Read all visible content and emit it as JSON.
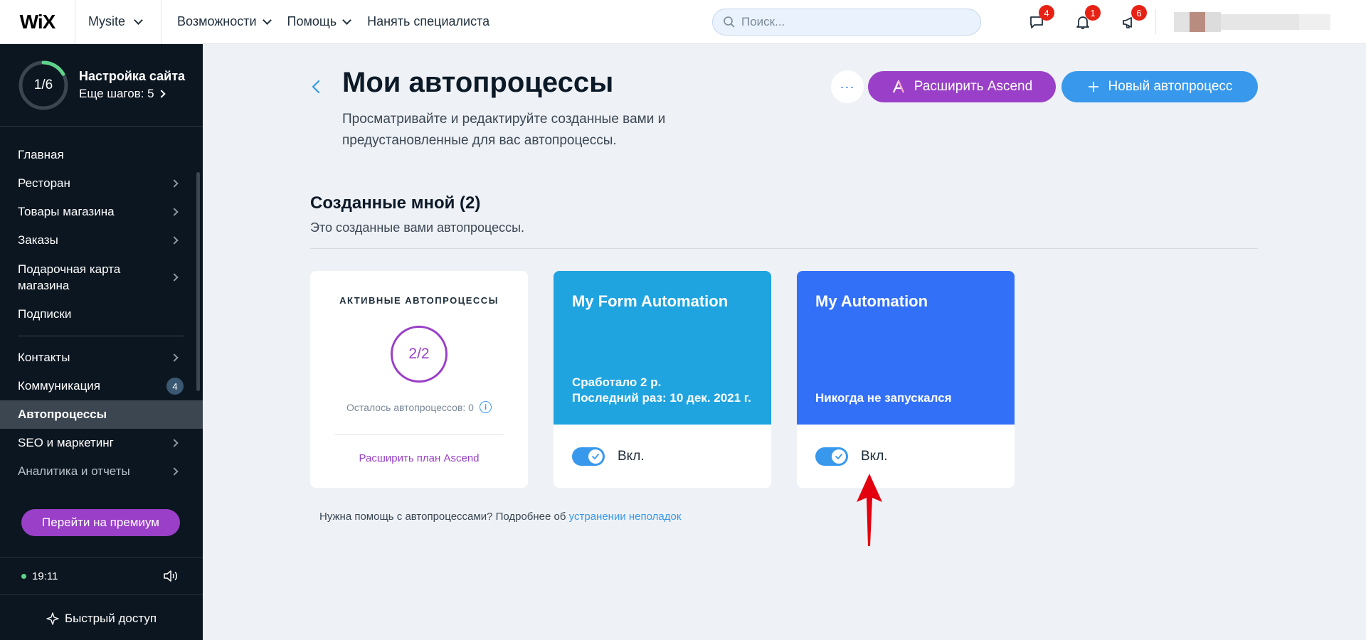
{
  "topbar": {
    "logo": "WiX",
    "site_name": "Mysite",
    "nav": [
      {
        "label": "Возможности",
        "has_dropdown": true
      },
      {
        "label": "Помощь",
        "has_dropdown": true
      },
      {
        "label": "Нанять специалиста",
        "has_dropdown": false
      }
    ],
    "search_placeholder": "Поиск...",
    "icons": [
      {
        "name": "chat-icon",
        "badge": "4"
      },
      {
        "name": "bell-icon",
        "badge": "1"
      },
      {
        "name": "megaphone-icon",
        "badge": "6"
      }
    ]
  },
  "sidebar": {
    "setup_progress_label": "1/6",
    "setup_progress_fraction": 0.1667,
    "setup_title": "Настройка сайта",
    "setup_sub": "Еще шагов: 5",
    "items_group1": [
      {
        "label": "Главная",
        "arrow": false
      },
      {
        "label": "Ресторан",
        "arrow": true
      },
      {
        "label": "Товары магазина",
        "arrow": true
      },
      {
        "label": "Заказы",
        "arrow": true
      },
      {
        "label": "Подарочная карта магазина",
        "arrow": true
      },
      {
        "label": "Подписки",
        "arrow": false
      }
    ],
    "items_group2": [
      {
        "label": "Контакты",
        "arrow": true
      },
      {
        "label": "Коммуникация",
        "count": "4"
      },
      {
        "label": "Автопроцессы",
        "active": true
      },
      {
        "label": "SEO и маркетинг",
        "arrow": true
      },
      {
        "label": "Аналитика и отчеты",
        "arrow": true
      }
    ],
    "premium_button": "Перейти на премиум",
    "time": "19:11",
    "quick_access": "Быстрый доступ"
  },
  "main": {
    "title": "Мои автопроцессы",
    "description": "Просматривайте и редактируйте созданные вами и предустановленные для вас автопроцессы.",
    "more_label": "···",
    "ascend_button": "Расширить Ascend",
    "new_button": "Новый автопроцесс",
    "section_title": "Созданные мной (2)",
    "section_subtitle": "Это созданные вами автопроцессы.",
    "stat_card": {
      "heading": "АКТИВНЫЕ АВТОПРОЦЕССЫ",
      "count": "2/2",
      "remaining": "Осталось автопроцессов: 0",
      "link": "Расширить план Ascend"
    },
    "automations": [
      {
        "name": "My Form Automation",
        "meta_line1": "Сработало 2 р.",
        "meta_line2": "Последний раз: 10 дек. 2021 г.",
        "toggle_label": "Вкл.",
        "enabled": true,
        "color": "#1fa4e0"
      },
      {
        "name": "My Automation",
        "meta_line1": "Никогда не запускался",
        "meta_line2": "",
        "toggle_label": "Вкл.",
        "enabled": true,
        "color": "#3370f8"
      }
    ],
    "help_text": "Нужна помощь с автопроцессами? Подробнее об",
    "help_link": "устранении неполадок"
  },
  "colors": {
    "accent_blue": "#3899ec",
    "ascend_purple": "#9a3fc8",
    "badge_red": "#e62214",
    "sidebar_bg": "#0c1620",
    "annotation_arrow": "#e3000f"
  }
}
